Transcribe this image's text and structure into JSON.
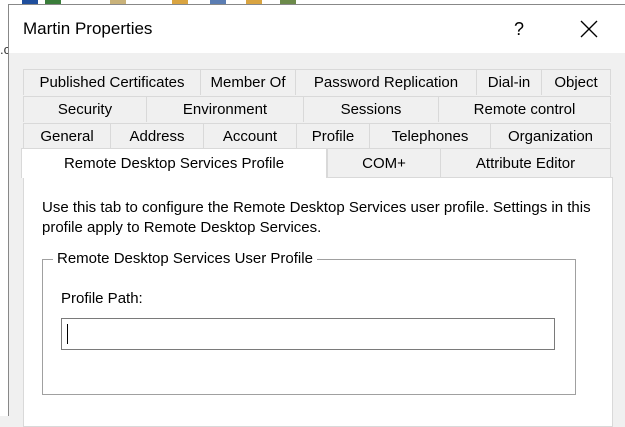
{
  "window": {
    "title": "Martin Properties",
    "help_label": "?"
  },
  "background": {
    "edge_char": ".c"
  },
  "tabs": {
    "row1": [
      "Published Certificates",
      "Member Of",
      "Password Replication",
      "Dial-in",
      "Object"
    ],
    "row2": [
      "Security",
      "Environment",
      "Sessions",
      "Remote control"
    ],
    "row3": [
      "General",
      "Address",
      "Account",
      "Profile",
      "Telephones",
      "Organization"
    ],
    "row4": [
      "Remote Desktop Services Profile",
      "COM+",
      "Attribute Editor"
    ],
    "active": "Remote Desktop Services Profile"
  },
  "page": {
    "description": "Use this tab to configure the Remote Desktop Services user profile. Settings in this profile apply to Remote Desktop Services.",
    "group_title": "Remote Desktop Services User Profile",
    "profile_path_label": "Profile Path:",
    "profile_path_value": ""
  }
}
